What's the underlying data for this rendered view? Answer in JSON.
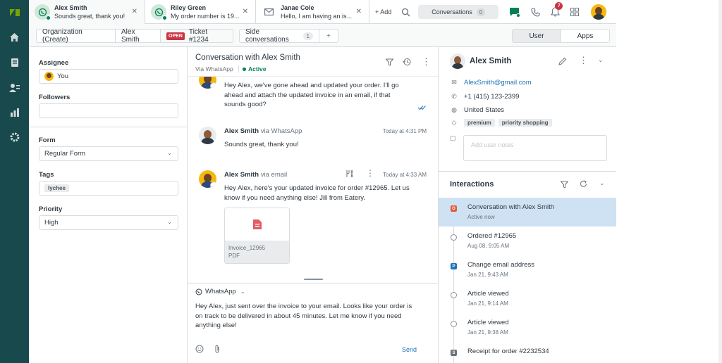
{
  "tabs": [
    {
      "name": "Alex Smith",
      "preview": "Sounds great, thank you!"
    },
    {
      "name": "Riley Green",
      "preview": "My order number is 19..."
    },
    {
      "name": "Janae Cole",
      "preview": "Hello, I am having an is..."
    }
  ],
  "topbar": {
    "add_label": "+ Add",
    "conversations_label": "Conversations",
    "conversations_count": "0",
    "notification_count": "7"
  },
  "subbar": {
    "crumb_org": "Organization (Create)",
    "crumb_user": "Alex Smith",
    "ticket_status": "OPEN",
    "ticket_label": "Ticket #1234",
    "side_conversations": "Side conversations",
    "side_count": "1",
    "side_add": "+",
    "user_tab": "User",
    "apps_tab": "Apps"
  },
  "left": {
    "assignee_label": "Assignee",
    "assignee_value": "You",
    "followers_label": "Followers",
    "form_label": "Form",
    "form_value": "Regular Form",
    "tags_label": "Tags",
    "tag_value": "lychee",
    "priority_label": "Priority",
    "priority_value": "High"
  },
  "conversation": {
    "title": "Conversation with Alex Smith",
    "channel": "Via WhatsApp",
    "status": "Active",
    "messages": [
      {
        "text1": "Hey Alex, we've gone ahead and updated your order. I'll go",
        "text2": "ahead and attach the updated invoice in an email, if that",
        "text3": "sounds good?"
      },
      {
        "sender": "Alex Smith",
        "via": "via WhatsApp",
        "time": "Today at 4:31 PM",
        "text1": "Sounds great, thank you!"
      },
      {
        "sender": "Alex Smith",
        "via": "via email",
        "time": "Today at 4:33 AM",
        "text1": "Hey Alex, here's your updated invoice for order #12965. Let us",
        "text2": "know if you need anything else! Jill from Eatery."
      }
    ],
    "attachment": {
      "name": "Invoice_12965",
      "type": "PDF"
    },
    "composer": {
      "channel": "WhatsApp",
      "line1": "Hey Alex, just sent over the invoice to your email. Looks like your order is",
      "line2": "on track to be delivered in about 45 minutes. Let me know if you need",
      "line3": "anything else!",
      "send_label": "Send"
    }
  },
  "user": {
    "name": "Alex Smith",
    "email": "AlexSmith@gmail.com",
    "phone": "+1 (415) 123-2399",
    "country": "United States",
    "tags": [
      "premium",
      "priority shopping"
    ],
    "notes_placeholder": "Add user notes"
  },
  "interactions": {
    "title": "Interactions",
    "items": [
      {
        "title": "Conversation with Alex Smith",
        "sub": "Active now",
        "marker": "O"
      },
      {
        "title": "Ordered #12965",
        "sub": "Aug 08, 9:05 AM"
      },
      {
        "title": "Change email address",
        "sub": "Jan 21, 9:43 AM",
        "marker": "P"
      },
      {
        "title": "Article viewed",
        "sub": "Jan 21, 9:14 AM"
      },
      {
        "title": "Article viewed",
        "sub": "Jan 21, 9:38 AM"
      },
      {
        "title": "Receipt for order #2232534",
        "sub": "",
        "marker": "S"
      }
    ]
  },
  "colors": {
    "rail": "#17494d",
    "accent_green": "#038153",
    "link_blue": "#1f73b7",
    "open_red": "#cc3340",
    "highlight": "#cfe2f3"
  }
}
